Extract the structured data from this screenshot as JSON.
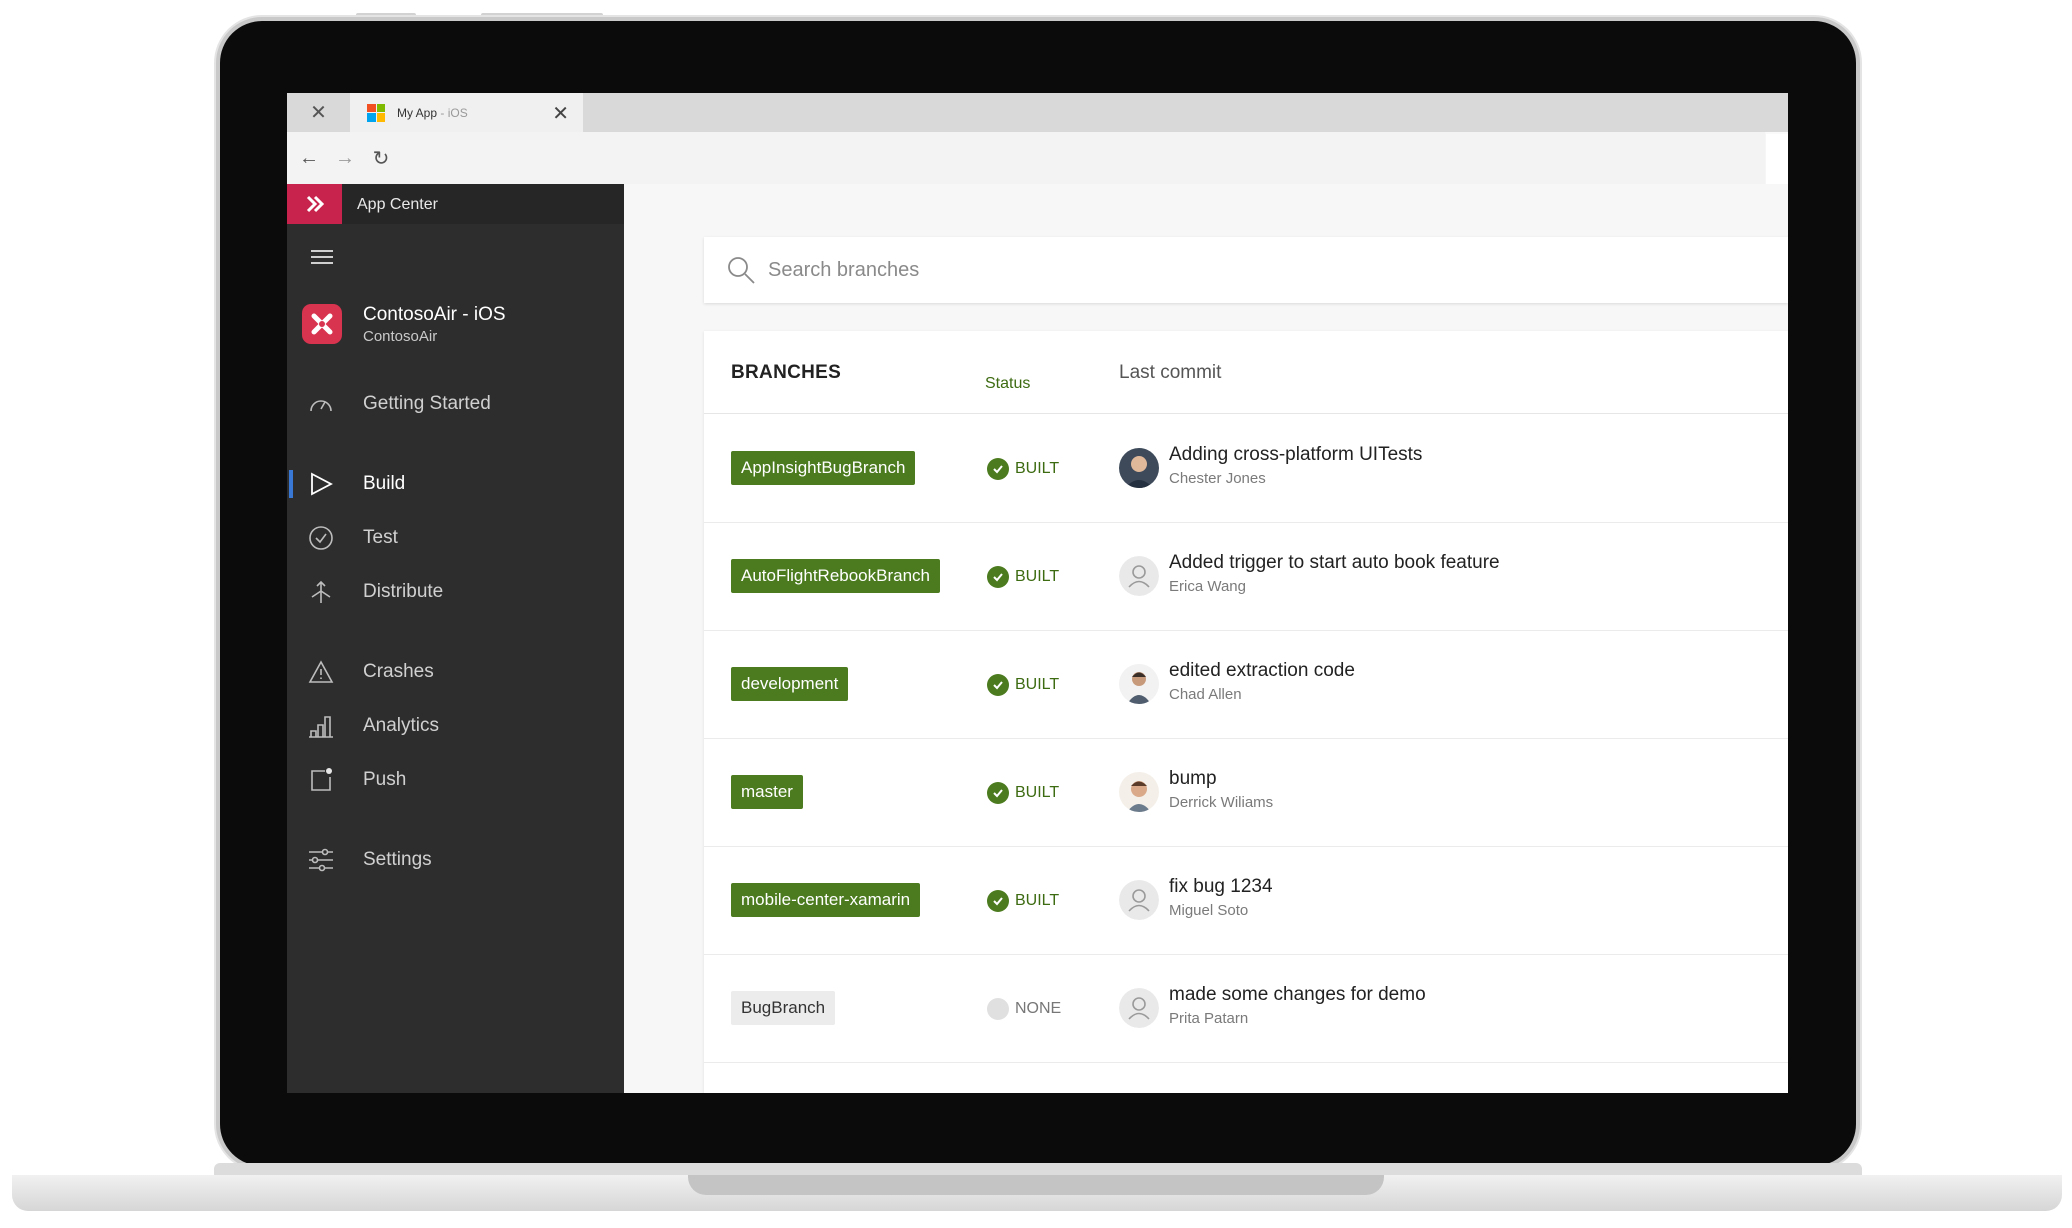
{
  "browser": {
    "tab_title": "My App",
    "tab_title_suffix": " - iOS"
  },
  "sidebar": {
    "service_name": "App Center",
    "app_name": "ContosoAir - iOS",
    "app_owner": "ContosoAir",
    "items": [
      {
        "label": "Getting Started",
        "icon": "speedometer-icon"
      },
      {
        "label": "Build",
        "icon": "play-triangle-icon",
        "active": true
      },
      {
        "label": "Test",
        "icon": "check-circle-icon"
      },
      {
        "label": "Distribute",
        "icon": "distribute-arrows-icon"
      },
      {
        "label": "Crashes",
        "icon": "warning-triangle-icon"
      },
      {
        "label": "Analytics",
        "icon": "bar-chart-icon"
      },
      {
        "label": "Push",
        "icon": "push-notification-icon"
      },
      {
        "label": "Settings",
        "icon": "sliders-icon"
      }
    ]
  },
  "search": {
    "placeholder": "Search branches"
  },
  "table": {
    "headers": {
      "branches": "BRANCHES",
      "status": "Status",
      "last_commit": "Last commit"
    },
    "rows": [
      {
        "branch": "AppInsightBugBranch",
        "status": "BUILT",
        "message": "Adding cross-platform UITests",
        "author": "Chester Jones",
        "avatar": "photo"
      },
      {
        "branch": "AutoFlightRebookBranch",
        "status": "BUILT",
        "message": "Added trigger to start auto book feature",
        "author": "Erica Wang",
        "avatar": "placeholder"
      },
      {
        "branch": "development",
        "status": "BUILT",
        "message": "edited extraction code",
        "author": "Chad Allen",
        "avatar": "photo"
      },
      {
        "branch": "master",
        "status": "BUILT",
        "message": "bump",
        "author": "Derrick Wiliams",
        "avatar": "photo"
      },
      {
        "branch": "mobile-center-xamarin",
        "status": "BUILT",
        "message": "fix bug 1234",
        "author": "Miguel Soto",
        "avatar": "placeholder"
      },
      {
        "branch": "BugBranch",
        "status": "NONE",
        "message": "made some changes for demo",
        "author": "Prita Patarn",
        "avatar": "placeholder"
      }
    ]
  },
  "colors": {
    "accent": "#c8234d",
    "built_green": "#4b7b1e",
    "sidebar_bg": "#2d2d2d",
    "active_indicator": "#3a78d6"
  }
}
